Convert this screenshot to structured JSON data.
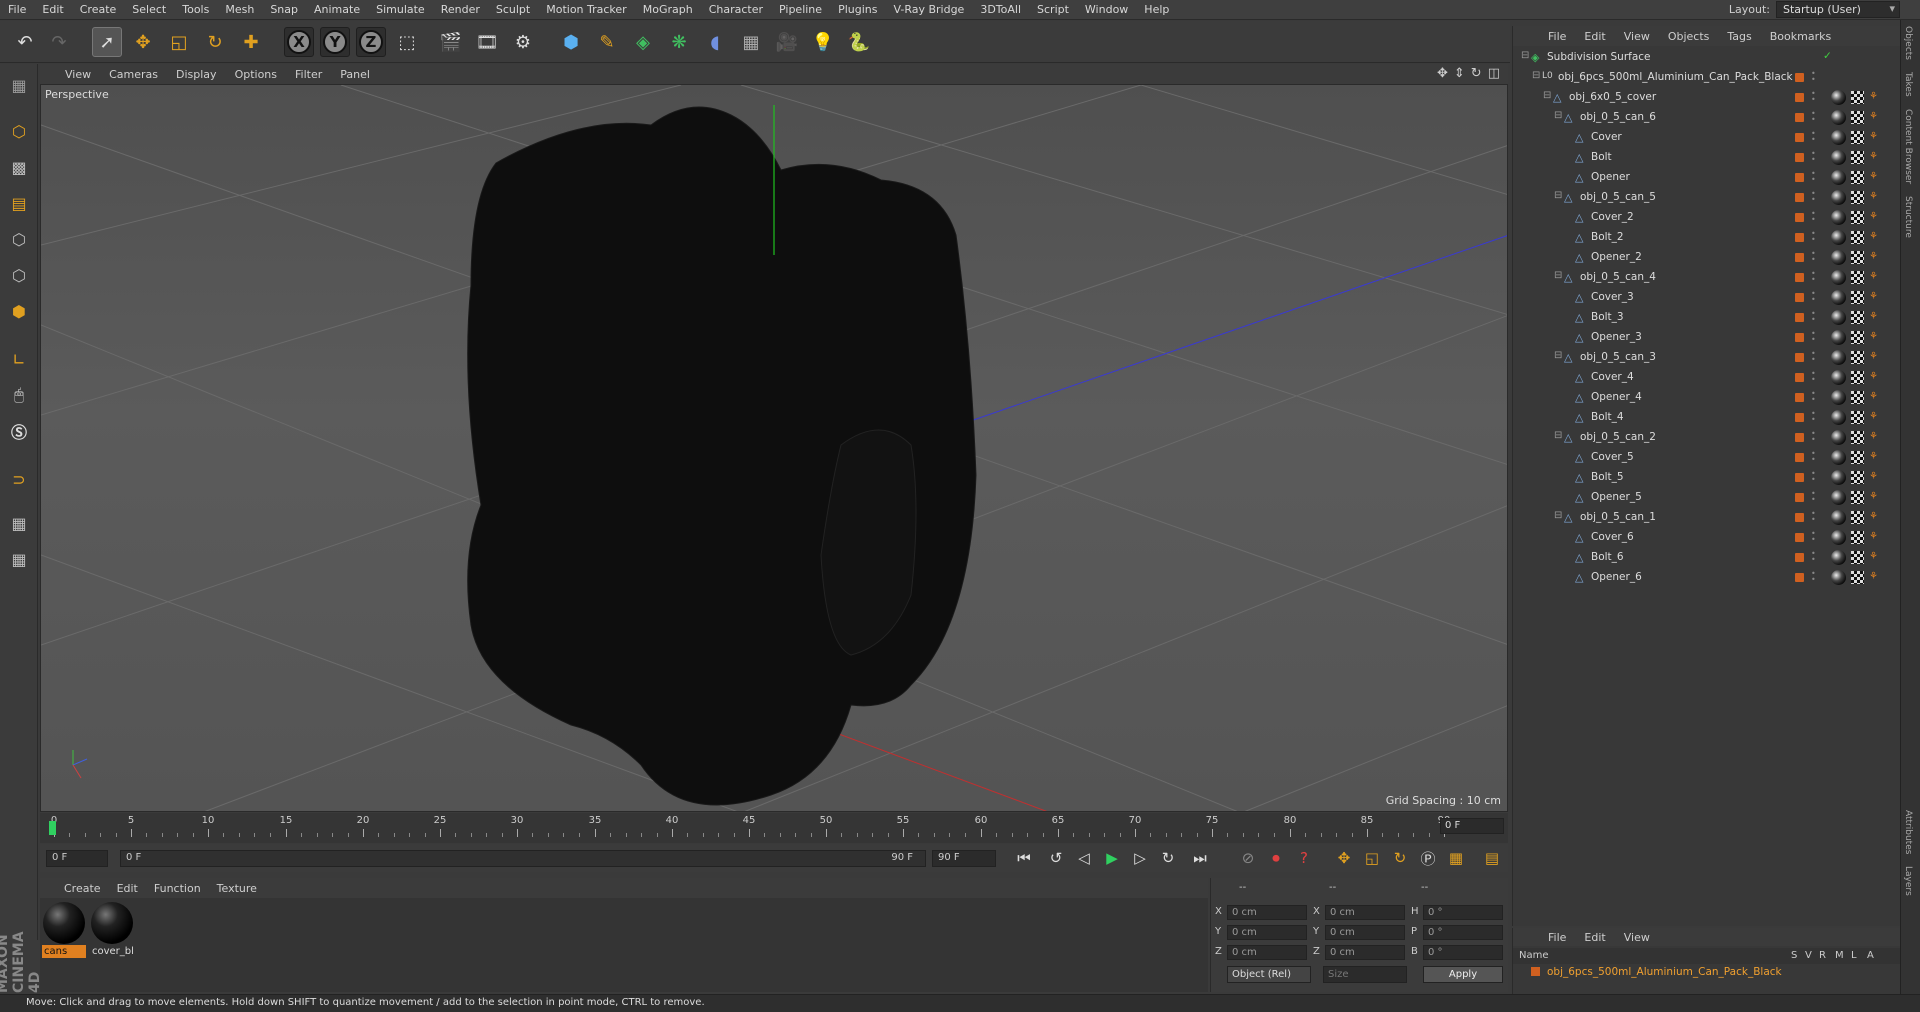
{
  "menu": [
    "File",
    "Edit",
    "Create",
    "Select",
    "Tools",
    "Mesh",
    "Snap",
    "Animate",
    "Simulate",
    "Render",
    "Sculpt",
    "Motion Tracker",
    "MoGraph",
    "Character",
    "Pipeline",
    "Plugins",
    "V-Ray Bridge",
    "3DToAll",
    "Script",
    "Window",
    "Help"
  ],
  "layout": {
    "label": "Layout:",
    "value": "Startup (User)"
  },
  "viewport": {
    "menu": [
      "View",
      "Cameras",
      "Display",
      "Options",
      "Filter",
      "Panel"
    ],
    "label": "Perspective",
    "grid_spacing": "Grid Spacing : 10 cm"
  },
  "timeline": {
    "ticks": [
      "0",
      "5",
      "10",
      "15",
      "20",
      "25",
      "30",
      "35",
      "40",
      "45",
      "50",
      "55",
      "60",
      "65",
      "70",
      "75",
      "80",
      "85",
      "90"
    ],
    "frame": "0 F"
  },
  "transport": {
    "start": "0 F",
    "range_start": "0 F",
    "range_end": "90 F",
    "end": "90 F"
  },
  "materials": {
    "menu": [
      "Create",
      "Edit",
      "Function",
      "Texture"
    ],
    "items": [
      {
        "name": "cans"
      },
      {
        "name": "cover_bl"
      }
    ]
  },
  "coords": {
    "head": [
      "--",
      "--",
      "--"
    ],
    "rows": [
      {
        "a": "X",
        "av": "0 cm",
        "b": "X",
        "bv": "0 cm",
        "c": "H",
        "cv": "0 °"
      },
      {
        "a": "Y",
        "av": "0 cm",
        "b": "Y",
        "bv": "0 cm",
        "c": "P",
        "cv": "0 °"
      },
      {
        "a": "Z",
        "av": "0 cm",
        "b": "Z",
        "bv": "0 cm",
        "c": "B",
        "cv": "0 °"
      }
    ],
    "mode": "Object (Rel)",
    "size": "Size",
    "apply": "Apply"
  },
  "objects": {
    "menu": [
      "File",
      "Edit",
      "View",
      "Objects",
      "Tags",
      "Bookmarks"
    ],
    "tree": [
      {
        "name": "Subdivision Surface",
        "depth": 0
      },
      {
        "name": "obj_6pcs_500ml_Aluminium_Can_Pack_Black",
        "depth": 1
      },
      {
        "name": "obj_6x0_5_cover",
        "depth": 2
      },
      {
        "name": "obj_0_5_can_6",
        "depth": 3
      },
      {
        "name": "Cover",
        "depth": 4
      },
      {
        "name": "Bolt",
        "depth": 4
      },
      {
        "name": "Opener",
        "depth": 4
      },
      {
        "name": "obj_0_5_can_5",
        "depth": 3
      },
      {
        "name": "Cover_2",
        "depth": 4
      },
      {
        "name": "Bolt_2",
        "depth": 4
      },
      {
        "name": "Opener_2",
        "depth": 4
      },
      {
        "name": "obj_0_5_can_4",
        "depth": 3
      },
      {
        "name": "Cover_3",
        "depth": 4
      },
      {
        "name": "Bolt_3",
        "depth": 4
      },
      {
        "name": "Opener_3",
        "depth": 4
      },
      {
        "name": "obj_0_5_can_3",
        "depth": 3
      },
      {
        "name": "Cover_4",
        "depth": 4
      },
      {
        "name": "Opener_4",
        "depth": 4
      },
      {
        "name": "Bolt_4",
        "depth": 4
      },
      {
        "name": "obj_0_5_can_2",
        "depth": 3
      },
      {
        "name": "Cover_5",
        "depth": 4
      },
      {
        "name": "Bolt_5",
        "depth": 4
      },
      {
        "name": "Opener_5",
        "depth": 4
      },
      {
        "name": "obj_0_5_can_1",
        "depth": 3
      },
      {
        "name": "Cover_6",
        "depth": 4
      },
      {
        "name": "Bolt_6",
        "depth": 4
      },
      {
        "name": "Opener_6",
        "depth": 4
      }
    ]
  },
  "layers": {
    "menu": [
      "File",
      "Edit",
      "View"
    ],
    "cols": [
      "Name",
      "S",
      "V",
      "R",
      "M",
      "L",
      "A"
    ],
    "row": "obj_6pcs_500ml_Aluminium_Can_Pack_Black"
  },
  "side_tabs": [
    "Objects",
    "Takes",
    "Content Browser",
    "Structure"
  ],
  "side_tabs_bottom": [
    "Attributes",
    "Layers"
  ],
  "brand": "MAXON CINEMA 4D",
  "status": "Move: Click and drag to move elements. Hold down SHIFT to quantize movement / add to the selection in point mode, CTRL to remove.",
  "colors": {
    "accent": "#e08020",
    "selected_text": "#f0a030"
  }
}
